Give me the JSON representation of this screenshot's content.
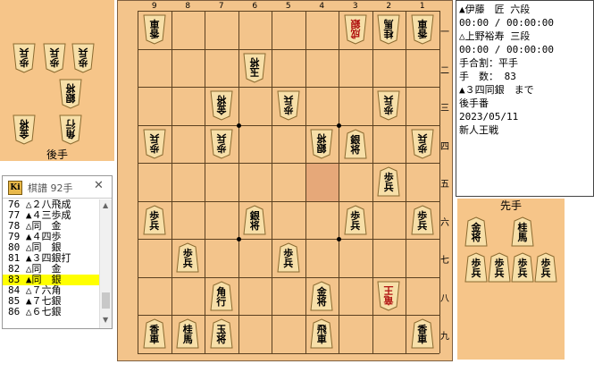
{
  "gote_label": "後手",
  "sente_label": "先手",
  "file_numbers": [
    "9",
    "8",
    "7",
    "6",
    "5",
    "4",
    "3",
    "2",
    "1"
  ],
  "rank_numbers": [
    "一",
    "二",
    "三",
    "四",
    "五",
    "六",
    "七",
    "八",
    "九"
  ],
  "info": {
    "sente_line": "▲伊藤　匠 六段",
    "sente_time": "00:00 / 00:00:00",
    "gote_line": "△上野裕寿 三段",
    "gote_time": "00:00 / 00:00:00",
    "handicap": "手合割：平手",
    "move_count": "手　数： 83",
    "last_move": "▲３四同銀　まで",
    "to_move": "後手番",
    "date": "2023/05/11",
    "event": "新人王戦"
  },
  "kifu": {
    "title": "棋譜 92手",
    "icon": "Ki",
    "close": "✕",
    "moves": [
      "76 △２八飛成",
      "77 ▲４三歩成",
      "78 △同　金",
      "79 ▲４四歩",
      "80 △同　銀",
      "81 ▲３四銀打",
      "82 △同　金",
      "83 ▲同　銀",
      "84 △７六角",
      "85 ▲７七銀",
      "86 △６七銀"
    ],
    "selected_index": 7
  },
  "board": {
    "pieces": [
      {
        "file": 9,
        "rank": 1,
        "side": "gote",
        "c": "香車"
      },
      {
        "file": 3,
        "rank": 1,
        "side": "gote",
        "c": "成銀"
      },
      {
        "file": 2,
        "rank": 1,
        "side": "gote",
        "c": "桂馬"
      },
      {
        "file": 1,
        "rank": 1,
        "side": "gote",
        "c": "香車"
      },
      {
        "file": 6,
        "rank": 2,
        "side": "gote",
        "c": "玉将"
      },
      {
        "file": 7,
        "rank": 3,
        "side": "gote",
        "c": "金将"
      },
      {
        "file": 5,
        "rank": 3,
        "side": "gote",
        "c": "歩兵"
      },
      {
        "file": 2,
        "rank": 3,
        "side": "gote",
        "c": "歩兵"
      },
      {
        "file": 9,
        "rank": 4,
        "side": "gote",
        "c": "歩兵"
      },
      {
        "file": 7,
        "rank": 4,
        "side": "gote",
        "c": "歩兵"
      },
      {
        "file": 4,
        "rank": 4,
        "side": "gote",
        "c": "銀将"
      },
      {
        "file": 3,
        "rank": 4,
        "side": "sente",
        "c": "銀将"
      },
      {
        "file": 1,
        "rank": 4,
        "side": "gote",
        "c": "歩兵"
      },
      {
        "file": 2,
        "rank": 5,
        "side": "sente",
        "c": "歩兵"
      },
      {
        "file": 9,
        "rank": 6,
        "side": "sente",
        "c": "歩兵"
      },
      {
        "file": 6,
        "rank": 6,
        "side": "sente",
        "c": "銀将"
      },
      {
        "file": 3,
        "rank": 6,
        "side": "sente",
        "c": "歩兵"
      },
      {
        "file": 1,
        "rank": 6,
        "side": "sente",
        "c": "歩兵"
      },
      {
        "file": 8,
        "rank": 7,
        "side": "sente",
        "c": "歩兵"
      },
      {
        "file": 5,
        "rank": 7,
        "side": "sente",
        "c": "歩兵"
      },
      {
        "file": 7,
        "rank": 8,
        "side": "sente",
        "c": "角行"
      },
      {
        "file": 4,
        "rank": 8,
        "side": "sente",
        "c": "金将"
      },
      {
        "file": 2,
        "rank": 8,
        "side": "gote",
        "c": "竜王"
      },
      {
        "file": 9,
        "rank": 9,
        "side": "sente",
        "c": "香車"
      },
      {
        "file": 8,
        "rank": 9,
        "side": "sente",
        "c": "桂馬"
      },
      {
        "file": 7,
        "rank": 9,
        "side": "sente",
        "c": "玉将"
      },
      {
        "file": 4,
        "rank": 9,
        "side": "sente",
        "c": "飛車"
      },
      {
        "file": 1,
        "rank": 9,
        "side": "sente",
        "c": "香車"
      }
    ],
    "highlight": {
      "file": 4,
      "rank": 5
    }
  },
  "gote_hand": [
    {
      "c": "歩兵"
    },
    {
      "c": "歩兵"
    },
    {
      "c": "歩兵"
    },
    {
      "c": "銀将"
    },
    {
      "c": "金将"
    },
    {
      "c": "角行"
    }
  ],
  "sente_hand": [
    {
      "c": "金将"
    },
    {
      "c": "桂馬"
    },
    {
      "c": "歩兵"
    },
    {
      "c": "歩兵"
    },
    {
      "c": "歩兵"
    },
    {
      "c": "歩兵"
    }
  ]
}
